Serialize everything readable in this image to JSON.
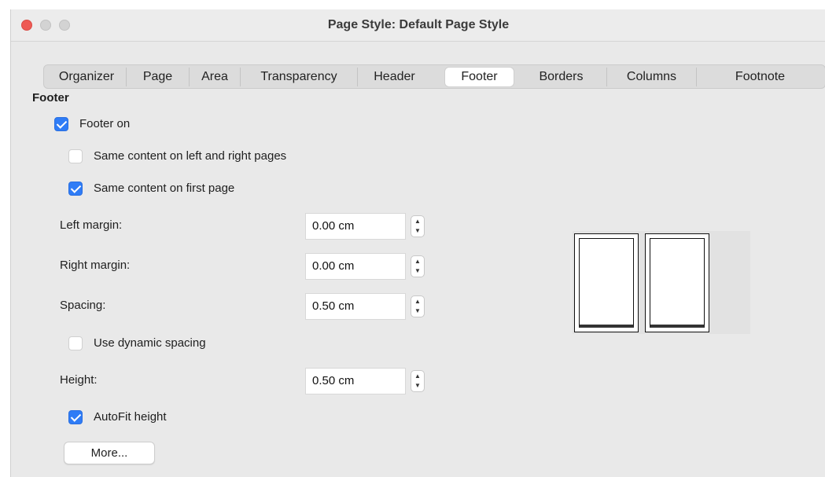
{
  "window": {
    "title": "Page Style: Default Page Style"
  },
  "tabs": [
    {
      "label": "Organizer",
      "selected": false
    },
    {
      "label": "Page",
      "selected": false
    },
    {
      "label": "Area",
      "selected": false
    },
    {
      "label": "Transparency",
      "selected": false
    },
    {
      "label": "Header",
      "selected": false
    },
    {
      "label": "Footer",
      "selected": true
    },
    {
      "label": "Borders",
      "selected": false
    },
    {
      "label": "Columns",
      "selected": false
    },
    {
      "label": "Footnote",
      "selected": false
    }
  ],
  "footer": {
    "section_title": "Footer",
    "footer_on": {
      "label": "Footer on",
      "checked": true
    },
    "same_left_right": {
      "label": "Same content on left and right pages",
      "checked": false
    },
    "same_first_page": {
      "label": "Same content on first page",
      "checked": true
    },
    "left_margin": {
      "label": "Left margin:",
      "value": "0.00 cm"
    },
    "right_margin": {
      "label": "Right margin:",
      "value": "0.00 cm"
    },
    "spacing": {
      "label": "Spacing:",
      "value": "0.50 cm"
    },
    "dynamic_spacing": {
      "label": "Use dynamic spacing",
      "checked": false
    },
    "height": {
      "label": "Height:",
      "value": "0.50 cm"
    },
    "autofit": {
      "label": "AutoFit height",
      "checked": true
    },
    "more_button": "More..."
  },
  "icons": {
    "spin_up": "chevron-up-icon",
    "spin_down": "chevron-down-icon"
  },
  "colors": {
    "accent": "#2f7cf6",
    "close": "#ee5a54"
  }
}
